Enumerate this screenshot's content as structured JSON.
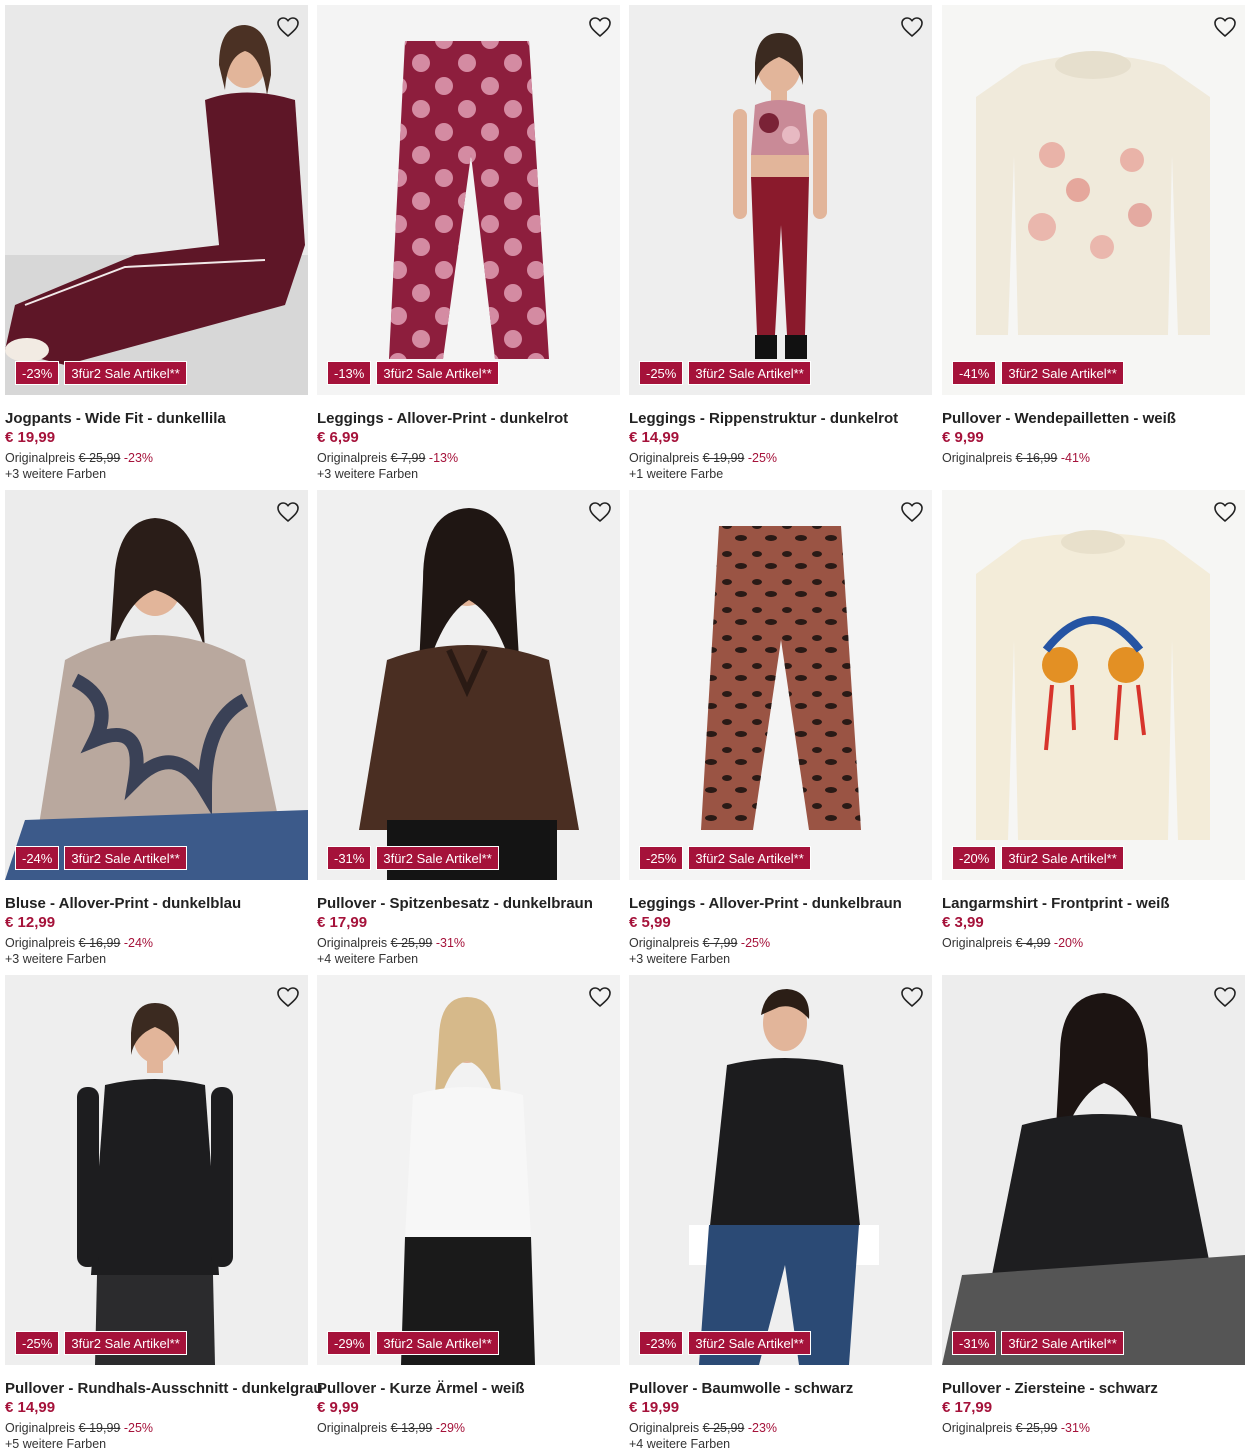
{
  "colors": {
    "accent": "#a5123a",
    "text": "#222222",
    "image_bg": "#f3f3f3"
  },
  "labels": {
    "orig_prefix": "Originalpreis",
    "promo": "3für2 Sale Artikel**",
    "wishlist_icon": "heart-outline-icon"
  },
  "products": [
    {
      "title": "Jogpants - Wide Fit - dunkellila",
      "price": "€ 19,99",
      "original": "€ 25,99",
      "discount": "-23%",
      "badge": "-23%",
      "colors": "+3 weitere Farben",
      "art": "woman-jogpants",
      "main_color": "#5e1627"
    },
    {
      "title": "Leggings - Allover-Print - dunkelrot",
      "price": "€ 6,99",
      "original": "€ 7,99",
      "discount": "-13%",
      "badge": "-13%",
      "colors": "+3 weitere Farben",
      "art": "leggings-dots",
      "main_color": "#8d1e3d"
    },
    {
      "title": "Leggings - Rippenstruktur - dunkelrot",
      "price": "€ 14,99",
      "original": "€ 19,99",
      "discount": "-25%",
      "badge": "-25%",
      "colors": "+1 weitere Farbe",
      "art": "woman-leggings",
      "main_color": "#8a1a2c"
    },
    {
      "title": "Pullover - Wendepailletten - weiß",
      "price": "€ 9,99",
      "original": "€ 16,99",
      "discount": "-41%",
      "badge": "-41%",
      "colors": "",
      "art": "sweater-cream",
      "main_color": "#f0eadb"
    },
    {
      "title": "Bluse - Allover-Print - dunkelblau",
      "price": "€ 12,99",
      "original": "€ 16,99",
      "discount": "-24%",
      "badge": "-24%",
      "colors": "+3 weitere Farben",
      "art": "woman-blouse",
      "main_color": "#3a4156"
    },
    {
      "title": "Pullover - Spitzenbesatz - dunkelbraun",
      "price": "€ 17,99",
      "original": "€ 25,99",
      "discount": "-31%",
      "badge": "-31%",
      "colors": "+4 weitere Farben",
      "art": "woman-brown",
      "main_color": "#4a2e22"
    },
    {
      "title": "Leggings - Allover-Print - dunkelbraun",
      "price": "€ 5,99",
      "original": "€ 7,99",
      "discount": "-25%",
      "badge": "-25%",
      "colors": "+3 weitere Farben",
      "art": "leggings-leo",
      "main_color": "#9a5444"
    },
    {
      "title": "Langarmshirt - Frontprint - weiß",
      "price": "€ 3,99",
      "original": "€ 4,99",
      "discount": "-20%",
      "badge": "-20%",
      "colors": "",
      "art": "shirt-print",
      "main_color": "#f3ecd9"
    },
    {
      "title": "Pullover - Rundhals-Ausschnitt - dunkelgrau",
      "price": "€ 14,99",
      "original": "€ 19,99",
      "discount": "-25%",
      "badge": "-25%",
      "colors": "+5 weitere Farben",
      "art": "man-black",
      "main_color": "#1d1d1f"
    },
    {
      "title": "Pullover - Kurze Ärmel - weiß",
      "price": "€ 9,99",
      "original": "€ 13,99",
      "discount": "-29%",
      "badge": "-29%",
      "colors": "",
      "art": "woman-white",
      "main_color": "#f7f7f7"
    },
    {
      "title": "Pullover - Baumwolle - schwarz",
      "price": "€ 19,99",
      "original": "€ 25,99",
      "discount": "-23%",
      "badge": "-23%",
      "colors": "+4 weitere Farben",
      "art": "man-sitting",
      "main_color": "#1c1c1e"
    },
    {
      "title": "Pullover - Ziersteine - schwarz",
      "price": "€ 17,99",
      "original": "€ 25,99",
      "discount": "-31%",
      "badge": "-31%",
      "colors": "",
      "art": "woman-black",
      "main_color": "#1e1e20"
    }
  ]
}
